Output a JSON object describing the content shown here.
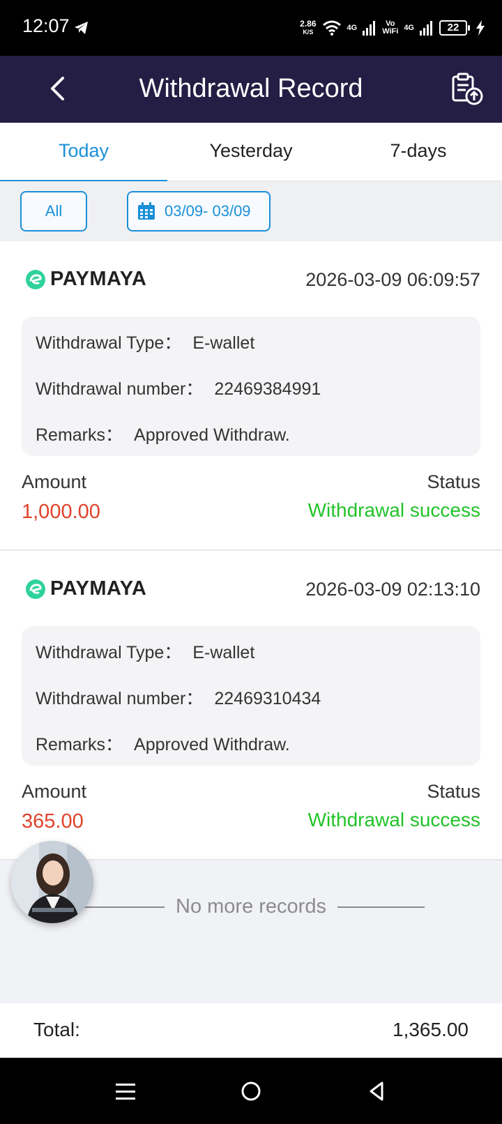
{
  "status_bar": {
    "time": "12:07",
    "net_speed_value": "2.86",
    "net_speed_unit": "K/S",
    "sig1_label": "4G",
    "volte_top": "Vo",
    "volte_bottom": "WiFi",
    "sig2_label": "4G",
    "battery": "22"
  },
  "header": {
    "title": "Withdrawal Record"
  },
  "tabs": [
    {
      "label": "Today"
    },
    {
      "label": "Yesterday"
    },
    {
      "label": "7-days"
    }
  ],
  "filter": {
    "all_label": "All",
    "date_range": "03/09- 03/09"
  },
  "records": [
    {
      "brand": "PAYMAYA",
      "time": "2026-03-09 06:09:57",
      "type_label": "Withdrawal Type：",
      "type_value": "E-wallet",
      "number_label": "Withdrawal number：",
      "number_value": "22469384991",
      "remarks_label": "Remarks：",
      "remarks_value": "Approved Withdraw.",
      "amount_label": "Amount",
      "amount_value": "1,000.00",
      "status_label": "Status",
      "status_value": "Withdrawal success"
    },
    {
      "brand": "PAYMAYA",
      "time": "2026-03-09 02:13:10",
      "type_label": "Withdrawal Type：",
      "type_value": "E-wallet",
      "number_label": "Withdrawal number：",
      "number_value": "22469310434",
      "remarks_label": "Remarks：",
      "remarks_value": "Approved Withdraw.",
      "amount_label": "Amount",
      "amount_value": "365.00",
      "status_label": "Status",
      "status_value": "Withdrawal success"
    }
  ],
  "no_more": "No more records",
  "total": {
    "label": "Total:",
    "value": "1,365.00"
  },
  "colors": {
    "header_bg": "#241d44",
    "accent_blue": "#1a8fd8",
    "amount_red": "#e0422b",
    "success_green": "#22c32a",
    "paymaya_green": "#2fd29a"
  },
  "icons": {
    "back": "back-arrow-icon",
    "upload": "clipboard-upload-icon",
    "calendar": "calendar-icon",
    "brand": "paymaya-logo-icon",
    "nav_menu": "menu-icon",
    "nav_home": "home-circle-icon",
    "nav_back": "back-triangle-icon"
  }
}
